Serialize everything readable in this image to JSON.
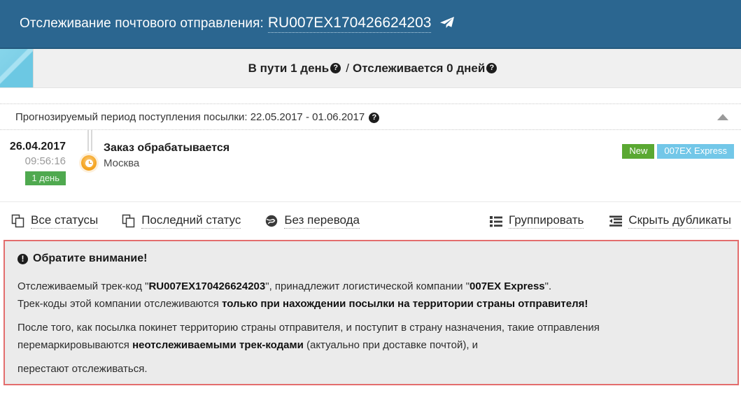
{
  "header": {
    "title": "Отслеживание почтового отправления:",
    "tracking_code": "RU007EX170426624203",
    "send_icon": "paper-plane-icon"
  },
  "summary": {
    "transit_label": "В пути 1 день",
    "separator": "/",
    "tracked_label": "Отслеживается 0 дней",
    "help_glyph": "?"
  },
  "forecast": {
    "text": "Прогнозируемый период поступления посылки: 22.05.2017 - 01.06.2017",
    "help_glyph": "?",
    "collapse_icon": "chevron-up-icon"
  },
  "timeline": {
    "entries": [
      {
        "date": "26.04.2017",
        "time": "09:56:16",
        "duration_badge": "1 день",
        "status": "Заказ обрабатывается",
        "place": "Москва",
        "tags": [
          {
            "label": "New",
            "type": "new"
          },
          {
            "label": "007EX Express",
            "type": "carrier"
          }
        ]
      }
    ]
  },
  "toolbar": {
    "left": [
      {
        "label": "Все статусы",
        "icon": "copy-pages-icon"
      },
      {
        "label": "Последний статус",
        "icon": "copy-pages-icon"
      },
      {
        "label": "Без перевода",
        "icon": "globe-icon"
      }
    ],
    "right": [
      {
        "label": "Группировать",
        "icon": "list-grouped-icon"
      },
      {
        "label": "Скрыть дубликаты",
        "icon": "list-indent-icon"
      }
    ]
  },
  "warning": {
    "icon": "exclamation-circle-icon",
    "title": "Обратите внимание!",
    "p1_a": "Отслеживаемый трек-код \"",
    "p1_b": "RU007EX170426624203",
    "p1_c": "\", принадлежит логистической компании \"",
    "p1_d": "007EX Express",
    "p1_e": "\".",
    "p2_a": "Трек-коды этой компании отслеживаются ",
    "p2_b": "только при нахождении посылки на территории страны отправителя!",
    "p3_a": "После того, как посылка покинет территорию страны отправителя, и поступит в страну назначения, такие отправления",
    "p3_b": "перемаркировываются ",
    "p3_c": "неотслеживаемыми трек-кодами",
    "p3_d": " (актуально при доставке почтой), и",
    "p4": "перестают отслеживаться."
  },
  "colors": {
    "header_blue": "#2b6690",
    "accent_green": "#4fa94f",
    "tag_new_green": "#5aa832",
    "tag_carrier_blue": "#72c7e8",
    "warning_border_red": "#e36d6d",
    "warning_bg": "#ebebeb",
    "clock_orange": "#f5a623"
  }
}
